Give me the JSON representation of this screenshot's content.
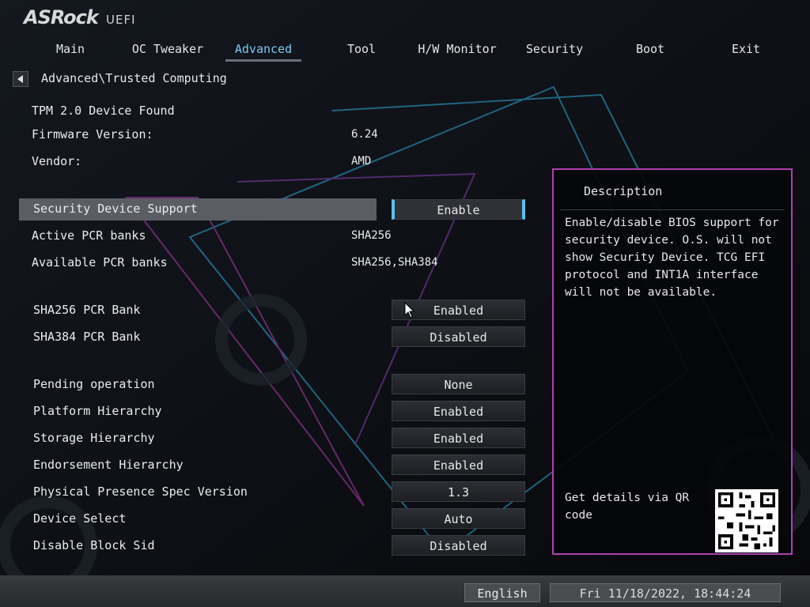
{
  "header": {
    "brand": "ASRock",
    "product": "UEFI"
  },
  "tabs": [
    {
      "label": "Main"
    },
    {
      "label": "OC Tweaker"
    },
    {
      "label": "Advanced",
      "active": true
    },
    {
      "label": "Tool"
    },
    {
      "label": "H/W Monitor"
    },
    {
      "label": "Security"
    },
    {
      "label": "Boot"
    },
    {
      "label": "Exit"
    }
  ],
  "breadcrumb": "Advanced\\Trusted Computing",
  "info": {
    "tpm_found": "TPM 2.0 Device Found",
    "firmware_label": "Firmware Version:",
    "firmware_value": "6.24",
    "vendor_label": "Vendor:",
    "vendor_value": "AMD"
  },
  "security_device": {
    "label": "Security Device Support",
    "value": "Enable"
  },
  "pcr": {
    "active_label": "Active PCR banks",
    "active_value": "SHA256",
    "available_label": "Available PCR banks",
    "available_value": "SHA256,SHA384"
  },
  "banks": {
    "sha256_label": "SHA256 PCR Bank",
    "sha256_value": "Enabled",
    "sha384_label": "SHA384 PCR Bank",
    "sha384_value": "Disabled"
  },
  "settings": {
    "pending_label": "Pending operation",
    "pending_value": "None",
    "platform_label": "Platform Hierarchy",
    "platform_value": "Enabled",
    "storage_label": "Storage Hierarchy",
    "storage_value": "Enabled",
    "endorsement_label": "Endorsement Hierarchy",
    "endorsement_value": "Enabled",
    "ppi_label": "Physical Presence Spec Version",
    "ppi_value": "1.3",
    "device_select_label": "Device Select",
    "device_select_value": "Auto",
    "block_sid_label": "Disable Block Sid",
    "block_sid_value": "Disabled"
  },
  "description": {
    "title": "Description",
    "body": "Enable/disable BIOS support for security device. O.S. will not show Security Device. TCG EFI protocol and INT1A interface will not be available.",
    "qr_text": "Get details via QR code"
  },
  "footer": {
    "language": "English",
    "datetime": "Fri 11/18/2022, 18:44:24"
  },
  "colors": {
    "accent_blue": "#5cc0ee",
    "panel_border": "#b03fb0",
    "highlight_row": "#5a5d63"
  }
}
